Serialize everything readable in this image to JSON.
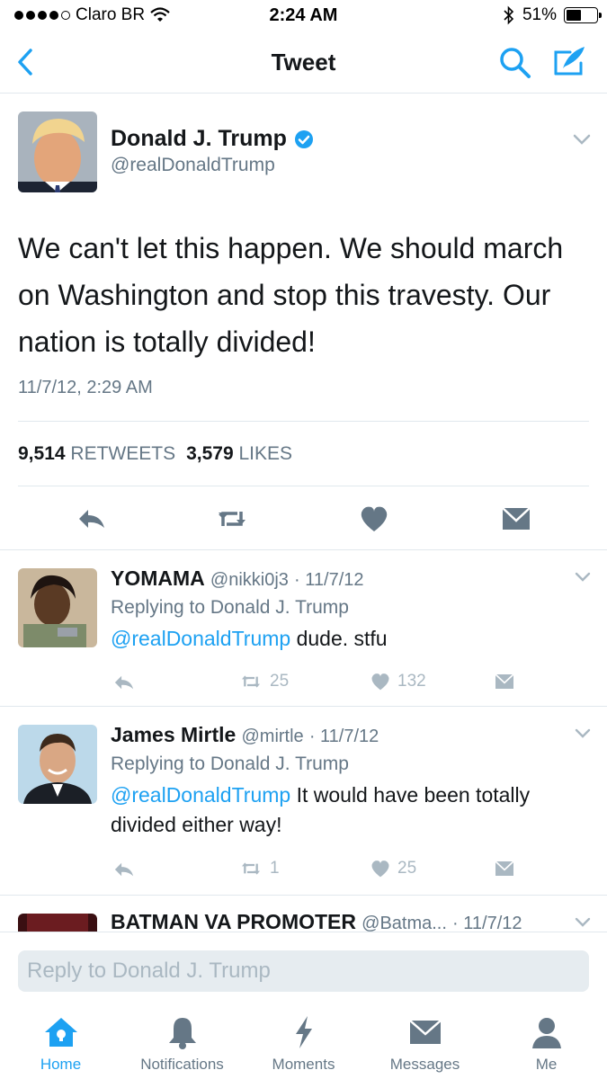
{
  "status_bar": {
    "carrier": "Claro BR",
    "time": "2:24 AM",
    "battery": "51%",
    "battery_level": 0.51
  },
  "navbar": {
    "title": "Tweet"
  },
  "main_tweet": {
    "name": "Donald J. Trump",
    "handle": "@realDonaldTrump",
    "verified": true,
    "text": "We can't let this happen. We should march on Washington and stop this travesty. Our nation is totally divided!",
    "timestamp": "11/7/12, 2:29 AM",
    "retweets_count": "9,514",
    "retweets_label": "RETWEETS",
    "likes_count": "3,579",
    "likes_label": "LIKES"
  },
  "replies": [
    {
      "name": "YOMAMA",
      "handle": "@nikki0j3",
      "date": "· 11/7/12",
      "replying_to": "Replying to Donald J. Trump",
      "mention": "@realDonaldTrump",
      "text": " dude. stfu",
      "retweets": "25",
      "likes": "132"
    },
    {
      "name": "James Mirtle",
      "handle": "@mirtle",
      "date": "· 11/7/12",
      "replying_to": "Replying to Donald J. Trump",
      "mention": "@realDonaldTrump",
      "text": " It would have been totally divided either way!",
      "retweets": "1",
      "likes": "25"
    },
    {
      "name": "BATMAN VA PROMOTER",
      "handle": "@Batma...",
      "date": "· 11/7/12"
    }
  ],
  "composer": {
    "placeholder": "Reply to Donald J. Trump"
  },
  "tabs": [
    {
      "label": "Home",
      "icon": "home-icon",
      "active": true
    },
    {
      "label": "Notifications",
      "icon": "bell-icon",
      "active": false
    },
    {
      "label": "Moments",
      "icon": "lightning-icon",
      "active": false
    },
    {
      "label": "Messages",
      "icon": "envelope-icon",
      "active": false
    },
    {
      "label": "Me",
      "icon": "person-icon",
      "active": false
    }
  ],
  "colors": {
    "accent": "#1da1f2",
    "secondary_text": "#657786",
    "muted_icon": "#aab8c2",
    "divider": "#e1e8ed"
  }
}
